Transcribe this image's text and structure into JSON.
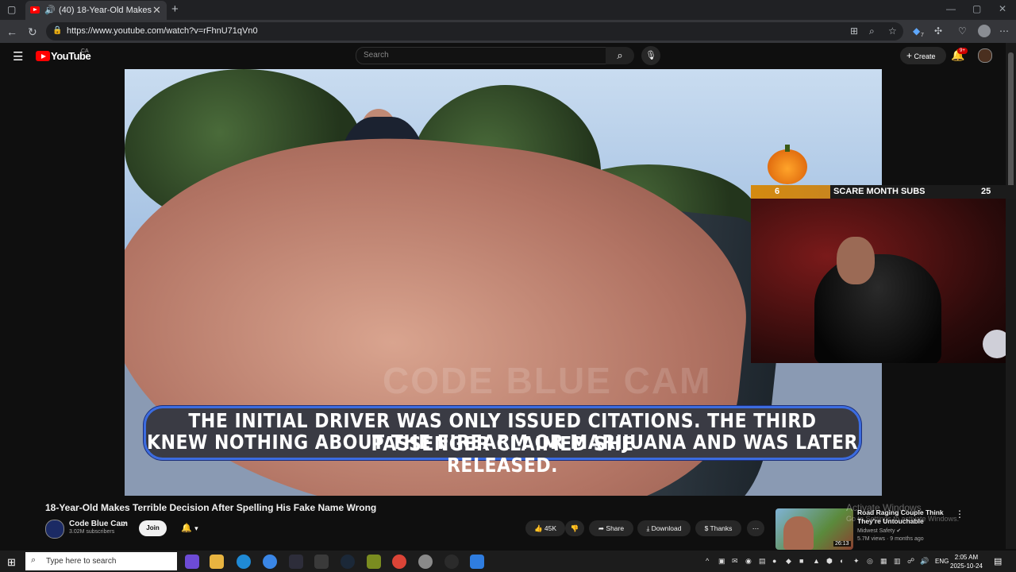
{
  "browser": {
    "tab_title": "(40) 18-Year-Old Makes Terrible Decision After Spelling His Fake Name Wrong",
    "tab_title_short": "(40) 18-Year-Old Makes Terri",
    "url": "https://www.youtube.com/watch?v=rFhnU71qVn0",
    "extension_badge": "7"
  },
  "youtube": {
    "logo_text": "YouTube",
    "country_code": "CA",
    "search_placeholder": "Search",
    "create_label": "Create",
    "notification_badge": "9+"
  },
  "video": {
    "caption_line1": "THE INITIAL DRIVER WAS ONLY ISSUED CITATIONS. THE THIRD PASSENGER CLAIMED SHE",
    "caption_line2": "KNEW NOTHING ABOUT THE FIREARM OR MARIJUANA AND WAS LATER RELEASED.",
    "watermark": "CODE BLUE CAM",
    "overlay": {
      "current_subs": "6",
      "label": "SCARE MONTH SUBS",
      "goal_subs": "25"
    },
    "title": "18-Year-Old Makes Terrible Decision After Spelling His Fake Name Wrong"
  },
  "channel": {
    "name": "Code Blue Cam",
    "subscribers": "3.02M subscribers",
    "join_label": "Join"
  },
  "actions": {
    "likes": "45K",
    "share": "Share",
    "download": "Download",
    "thanks": "Thanks"
  },
  "recommended": {
    "title": "Road Raging Couple Think They're Untouchable",
    "channel": "Midwest Safety",
    "meta": "5.7M views · 9 months ago",
    "duration": "26:13"
  },
  "windows_watermark": {
    "line1": "Activate Windows",
    "line2": "Go to Settings to activate Windows."
  },
  "taskbar": {
    "search_placeholder": "Type here to search",
    "language": "ENG",
    "time": "2:05 AM",
    "date": "2025-10-24"
  },
  "colors": {
    "yt_red": "#ff0000",
    "caption_border": "#3c6ce0",
    "overlay_orange": "#d48a10"
  }
}
